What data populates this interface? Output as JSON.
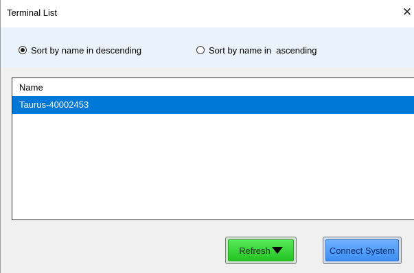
{
  "window": {
    "title": "Terminal List",
    "close_glyph": "✕"
  },
  "sort": {
    "options": [
      {
        "label": "Sort by name in descending",
        "checked": true
      },
      {
        "label": "Sort by name in  ascending",
        "checked": false
      }
    ]
  },
  "list": {
    "header": "Name",
    "rows": [
      {
        "name": "Taurus-40002453",
        "selected": true
      }
    ]
  },
  "buttons": {
    "refresh_label": "Refresh",
    "refresh_icon": "triangle-down-icon",
    "connect_label": "Connect System"
  },
  "colors": {
    "selection": "#0078d7",
    "refresh_green": "#3ad63a",
    "connect_blue": "#4f9bf7",
    "panel_tint": "#eaf2fb"
  }
}
